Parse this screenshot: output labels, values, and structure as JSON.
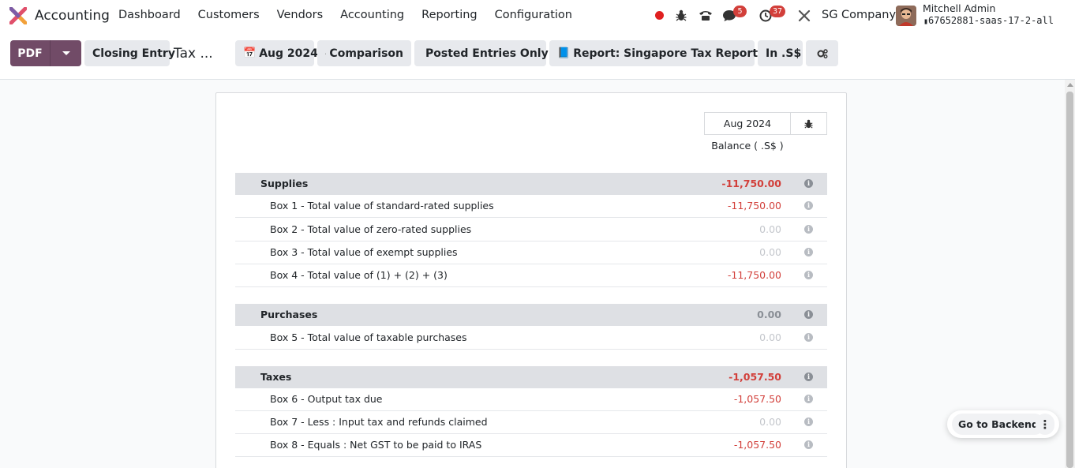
{
  "navbar": {
    "app_name": "Accounting",
    "menu": [
      "Dashboard",
      "Customers",
      "Vendors",
      "Accounting",
      "Reporting",
      "Configuration"
    ],
    "messages_count": "5",
    "activities_count": "37",
    "company": "SG Company",
    "user_name": "Mitchell Admin",
    "database": "67652881-saas-17-2-all"
  },
  "control": {
    "pdf_label": "PDF",
    "closing_entry_label": "Closing Entry",
    "breadcrumb": "Tax ...",
    "filters": {
      "date": "Aug 2024",
      "comparison": "Comparison",
      "posted": "Posted Entries Only",
      "report": "Report: Singapore Tax Report (SG)",
      "currency": "In .S$"
    }
  },
  "report": {
    "column_header": "Aug 2024",
    "column_sub": "Balance ( .S$ )",
    "sections": [
      {
        "title": "Supplies",
        "total": "-11,750.00",
        "lines": [
          {
            "label": "Box 1 - Total value of standard-rated supplies",
            "value": "-11,750.00"
          },
          {
            "label": "Box 2 - Total value of zero-rated supplies",
            "value": "0.00"
          },
          {
            "label": "Box 3 - Total value of exempt supplies",
            "value": "0.00"
          },
          {
            "label": "Box 4 - Total value of (1) + (2) + (3)",
            "value": "-11,750.00"
          }
        ]
      },
      {
        "title": "Purchases",
        "total": "0.00",
        "lines": [
          {
            "label": "Box 5 - Total value of taxable purchases",
            "value": "0.00"
          }
        ]
      },
      {
        "title": "Taxes",
        "total": "-1,057.50",
        "lines": [
          {
            "label": "Box 6 - Output tax due",
            "value": "-1,057.50"
          },
          {
            "label": "Box 7 - Less : Input tax and refunds claimed",
            "value": "0.00"
          },
          {
            "label": "Box 8 - Equals : Net GST to be paid to IRAS",
            "value": "-1,057.50"
          }
        ]
      }
    ]
  },
  "floating": {
    "backend_label": "Go to Backend"
  },
  "colors": {
    "brand": "#714b67",
    "negative": "#d23f3a",
    "badge": "#d23f3a"
  }
}
